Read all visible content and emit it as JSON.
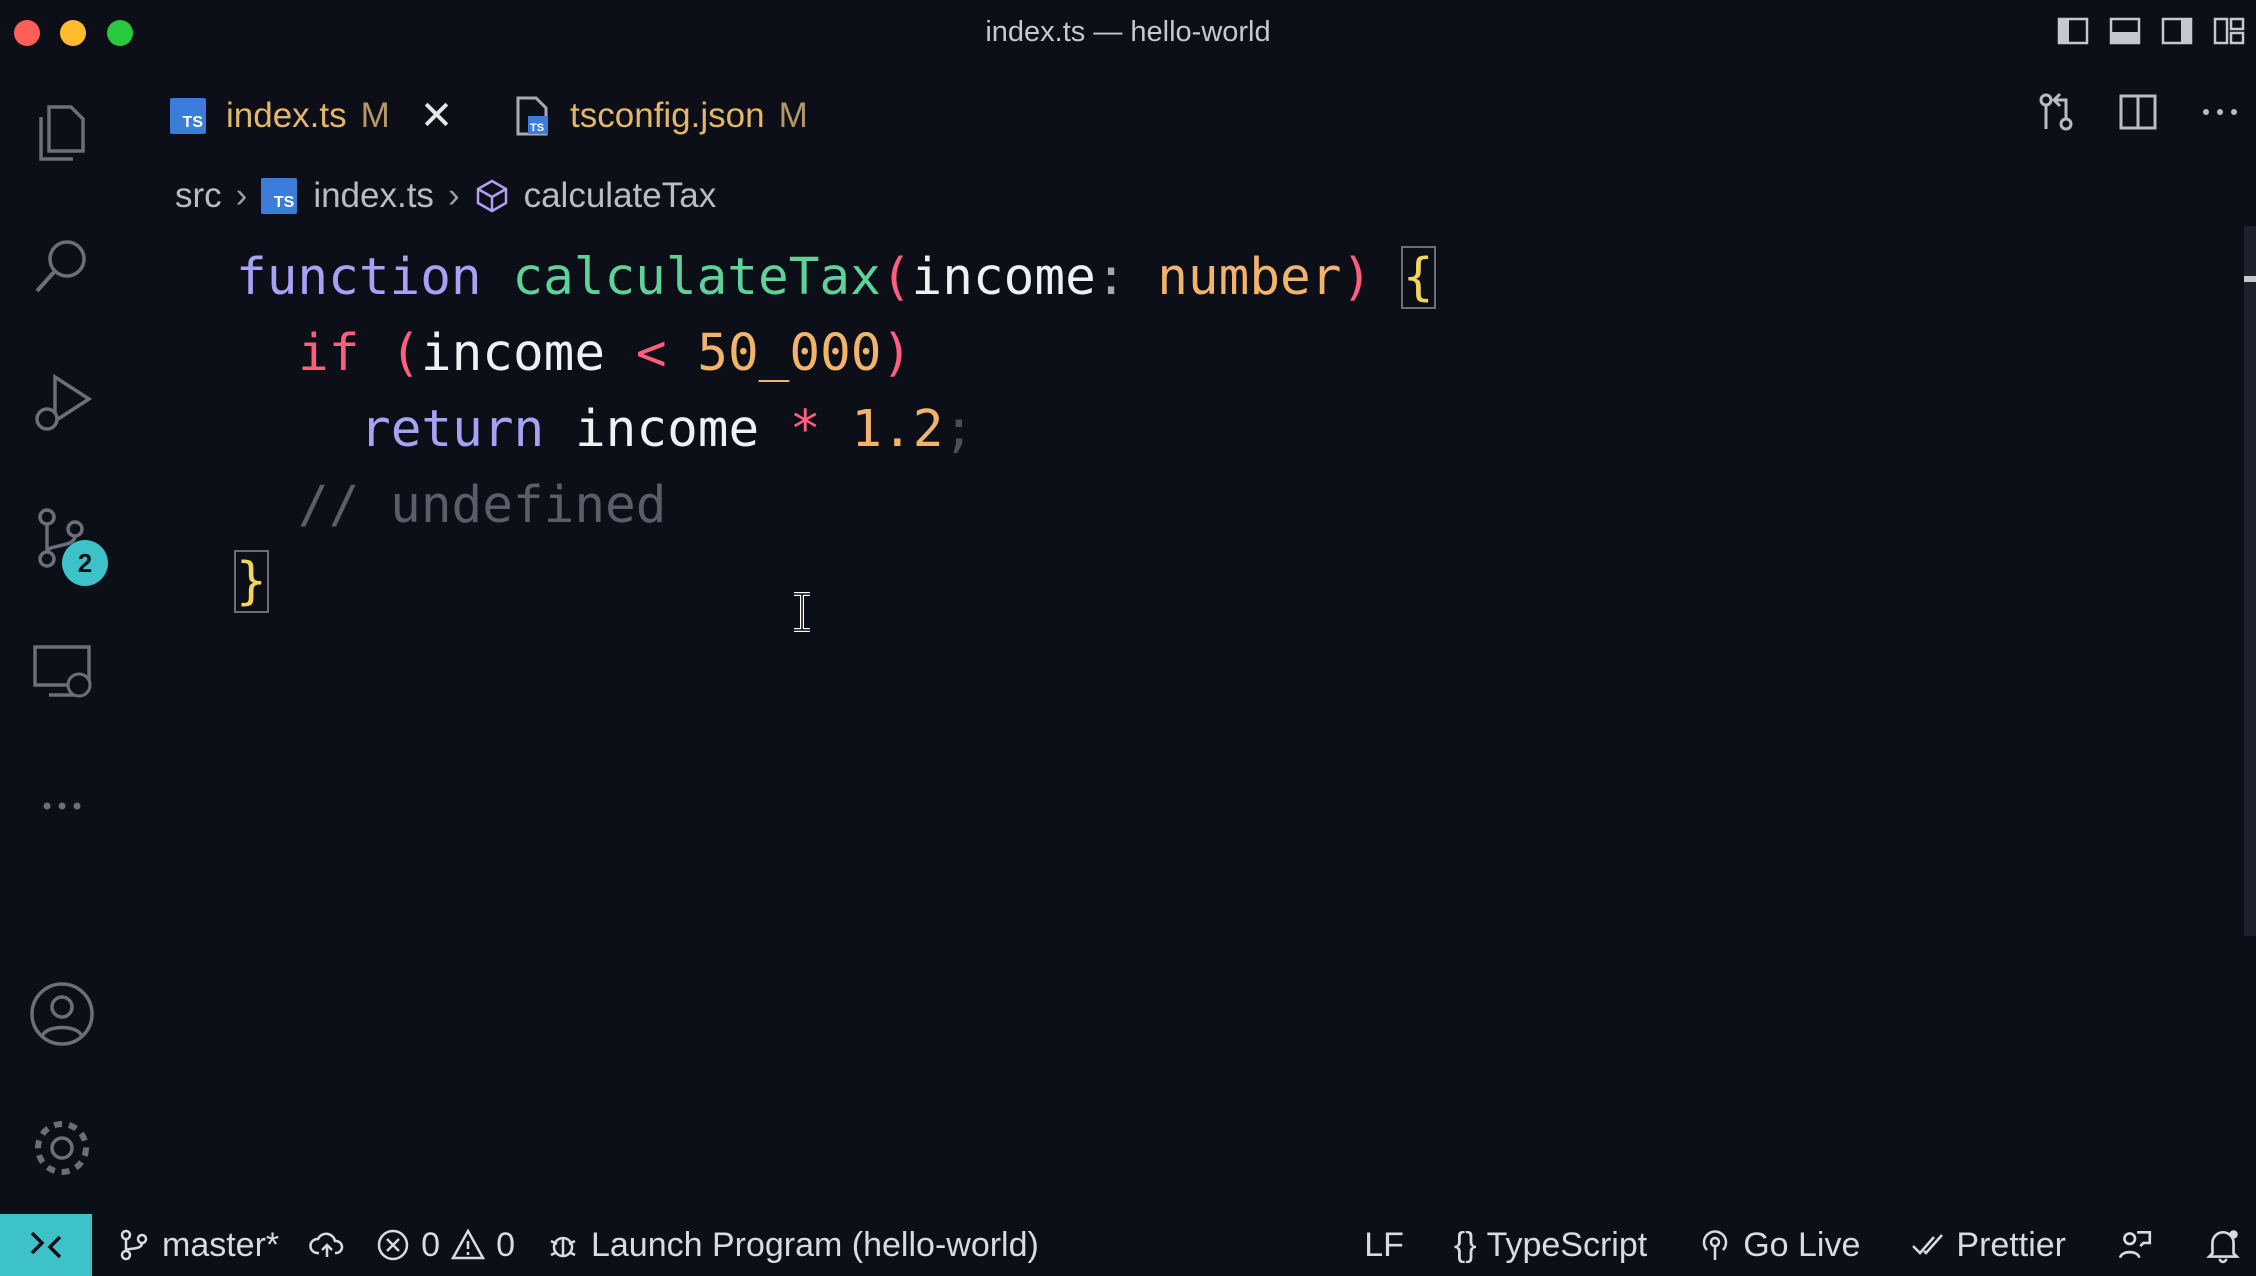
{
  "window": {
    "title": "index.ts — hello-world"
  },
  "activity_bar": {
    "source_control_badge": "2"
  },
  "tabs": [
    {
      "label": "index.ts",
      "status": "M",
      "icon": "typescript-file-icon",
      "active": true
    },
    {
      "label": "tsconfig.json",
      "status": "M",
      "icon": "tsconfig-file-icon",
      "active": false
    }
  ],
  "breadcrumb": {
    "folder": "src",
    "file": "index.ts",
    "symbol": "calculateTax"
  },
  "code": {
    "line1": {
      "kw": "function",
      "fn": "calculateTax",
      "open": "(",
      "param": "income",
      "colon": ":",
      "type": "number",
      "close": ")",
      "brace": "{"
    },
    "line2": {
      "kw": "if",
      "open": "(",
      "id": "income",
      "op": "<",
      "num": "50_000",
      "close": ")"
    },
    "line3": {
      "kw": "return",
      "id": "income",
      "op": "*",
      "num": "1.2",
      "semi": ";"
    },
    "line4": {
      "comment": "// undefined"
    },
    "line5": {
      "brace": "}"
    }
  },
  "status_bar": {
    "branch": "master*",
    "errors": "0",
    "warnings": "0",
    "launch": "Launch Program (hello-world)",
    "eol": "LF",
    "language": "TypeScript",
    "go_live": "Go Live",
    "prettier": "Prettier"
  },
  "colors": {
    "accent": "#3ec2c9",
    "keyword": "#a6a3f5",
    "function": "#5fd29a",
    "type": "#f2b46b",
    "operator": "#ff5e7e",
    "tab_modified": "#e3b66b"
  }
}
